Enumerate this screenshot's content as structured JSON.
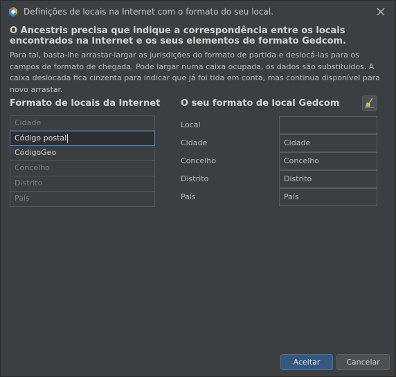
{
  "window": {
    "title": "Definições de locais na Internet com o formato do seu local."
  },
  "header": {
    "headline": "O Ancestris precisa que indique a correspondência entre os locais encontrados na Internet e os seus elementos de formato Gedcom.",
    "description": "Para tal, basta-lhe arrastar-largar as jurisdições do formato de partida e deslocá-las para os campos de formato de chegada. Pode largar numa caixa ocupada, os dados são substituídos. A caixa deslocada fica cinzenta para indicar que já foi tida em conta, mas continua disponível para novo arrastar."
  },
  "source": {
    "title": "Formato de locais da Internet",
    "items": [
      {
        "label": "Cidade",
        "state": "used"
      },
      {
        "label": "Código postal",
        "state": "selected"
      },
      {
        "label": "CódigoGeo",
        "state": "available"
      },
      {
        "label": "Concelho",
        "state": "used"
      },
      {
        "label": "Distrito",
        "state": "used"
      },
      {
        "label": "País",
        "state": "used"
      }
    ]
  },
  "target": {
    "title": "O seu formato de local Gedcom",
    "clear_icon": "broom-icon",
    "rows": [
      {
        "label": "Local",
        "value": ""
      },
      {
        "label": "Cidade",
        "value": "Cidade"
      },
      {
        "label": "Concelho",
        "value": "Concelho"
      },
      {
        "label": "Distrito",
        "value": "Distrito"
      },
      {
        "label": "País",
        "value": "País"
      }
    ]
  },
  "footer": {
    "ok_label": "Aceitar",
    "cancel_label": "Cancelar"
  },
  "colors": {
    "background": "#3c3f41",
    "accent": "#365880",
    "selection_border": "#4a88c7"
  }
}
